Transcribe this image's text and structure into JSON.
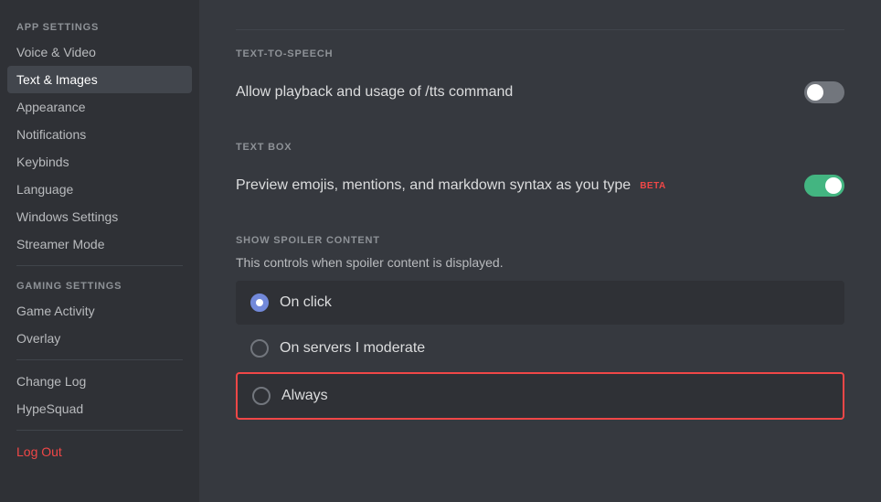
{
  "sidebar": {
    "app_settings_label": "APP SETTINGS",
    "gaming_settings_label": "GAMING SETTINGS",
    "items_app": [
      {
        "id": "voice-video",
        "label": "Voice & Video",
        "active": false
      },
      {
        "id": "text-images",
        "label": "Text & Images",
        "active": true
      },
      {
        "id": "appearance",
        "label": "Appearance",
        "active": false
      },
      {
        "id": "notifications",
        "label": "Notifications",
        "active": false
      },
      {
        "id": "keybinds",
        "label": "Keybinds",
        "active": false
      },
      {
        "id": "language",
        "label": "Language",
        "active": false
      },
      {
        "id": "windows-settings",
        "label": "Windows Settings",
        "active": false
      },
      {
        "id": "streamer-mode",
        "label": "Streamer Mode",
        "active": false
      }
    ],
    "items_gaming": [
      {
        "id": "game-activity",
        "label": "Game Activity",
        "active": false
      },
      {
        "id": "overlay",
        "label": "Overlay",
        "active": false
      }
    ],
    "items_misc": [
      {
        "id": "change-log",
        "label": "Change Log",
        "active": false
      },
      {
        "id": "hypesquad",
        "label": "HypeSquad",
        "active": false
      }
    ],
    "logout_label": "Log Out"
  },
  "main": {
    "tts_section_label": "TEXT-TO-SPEECH",
    "tts_setting_text": "Allow playback and usage of /tts command",
    "tts_toggle_state": "off",
    "textbox_section_label": "TEXT BOX",
    "textbox_setting_text": "Preview emojis, mentions, and markdown syntax as you type",
    "textbox_beta_label": "BETA",
    "textbox_toggle_state": "on",
    "spoiler_section_label": "SHOW SPOILER CONTENT",
    "spoiler_description": "This controls when spoiler content is displayed.",
    "radio_options": [
      {
        "id": "on-click",
        "label": "On click",
        "selected": true,
        "focused": false
      },
      {
        "id": "on-servers",
        "label": "On servers I moderate",
        "selected": false,
        "focused": false
      },
      {
        "id": "always",
        "label": "Always",
        "selected": false,
        "focused": true
      }
    ]
  }
}
